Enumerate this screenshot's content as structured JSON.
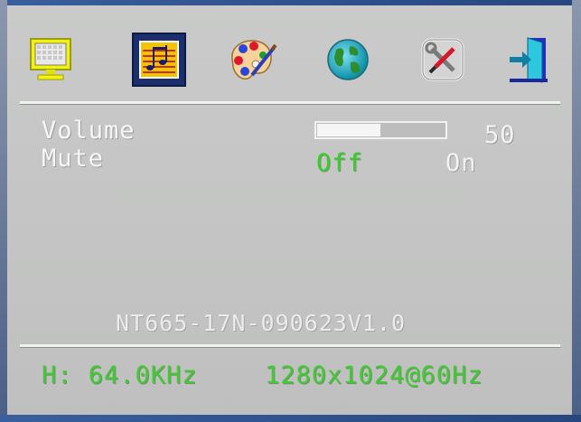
{
  "menu": {
    "icons": [
      {
        "name": "picture-monitor-icon",
        "selected": false
      },
      {
        "name": "audio-music-icon",
        "selected": true
      },
      {
        "name": "color-palette-icon",
        "selected": false
      },
      {
        "name": "globe-language-icon",
        "selected": false
      },
      {
        "name": "tools-setup-icon",
        "selected": false
      },
      {
        "name": "exit-door-icon",
        "selected": false
      }
    ]
  },
  "audio": {
    "volume_label": "Volume",
    "volume_value": "50",
    "volume_level_percent": 50,
    "mute_label": "Mute",
    "mute_off": "Off",
    "mute_on": "On"
  },
  "footer": {
    "model": "NT665-17N-090623V1.0",
    "h_freq": "H: 64.0KHz",
    "resolution": "1280x1024@60Hz"
  },
  "colors": {
    "active_text": "#3ecb2f",
    "selected_tab_bg": "#1c2f6b",
    "background": "#c6c7c6"
  }
}
